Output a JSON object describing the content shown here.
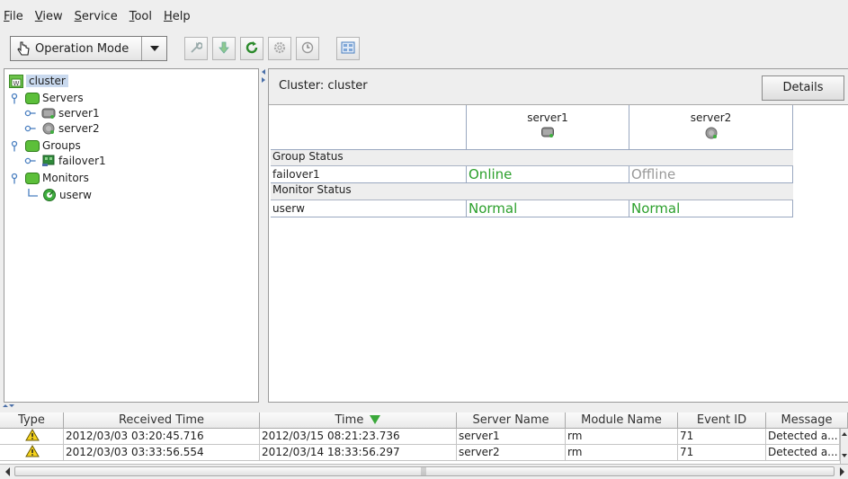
{
  "menu": [
    {
      "mnemonic": "F",
      "rest": "ile"
    },
    {
      "mnemonic": "V",
      "rest": "iew"
    },
    {
      "mnemonic": "S",
      "rest": "ervice"
    },
    {
      "mnemonic": "T",
      "rest": "ool"
    },
    {
      "mnemonic": "H",
      "rest": "elp"
    }
  ],
  "toolbar": {
    "mode_label": "Operation Mode",
    "icons": [
      "cursor-hand-icon",
      "dropdown-arrow-icon",
      "wrench-icon",
      "down-arrow-icon",
      "refresh-icon",
      "gear-icon",
      "clock-icon",
      "cluster-view-icon"
    ]
  },
  "tree": {
    "root": "cluster",
    "servers_label": "Servers",
    "server1": "server1",
    "server2": "server2",
    "groups_label": "Groups",
    "group1": "failover1",
    "monitors_label": "Monitors",
    "monitor1": "userw"
  },
  "panel": {
    "title": "Cluster: cluster",
    "details_label": "Details",
    "server_headers": [
      "server1",
      "server2"
    ],
    "group_section": "Group Status",
    "group_name": "failover1",
    "group_states": [
      "Online",
      "Offline"
    ],
    "monitor_section": "Monitor Status",
    "monitor_name": "userw",
    "monitor_states": [
      "Normal",
      "Normal"
    ],
    "colors": {
      "ok": "#2ca02c",
      "offline": "#999999"
    }
  },
  "log": {
    "headers": [
      "Type",
      "Received Time",
      "Time",
      "Server Name",
      "Module Name",
      "Event ID",
      "Message"
    ],
    "sort_icon": "sort-descending-icon",
    "rows": [
      {
        "type_icon": "warning-icon",
        "received": "2012/03/03 03:20:45.716",
        "time": "2012/03/15 08:21:23.736",
        "server": "server1",
        "module": "rm",
        "event": "71",
        "message": "Detected a..."
      },
      {
        "type_icon": "warning-icon",
        "received": "2012/03/03 03:33:56.554",
        "time": "2012/03/14 18:33:56.297",
        "server": "server2",
        "module": "rm",
        "event": "71",
        "message": "Detected a..."
      }
    ]
  }
}
